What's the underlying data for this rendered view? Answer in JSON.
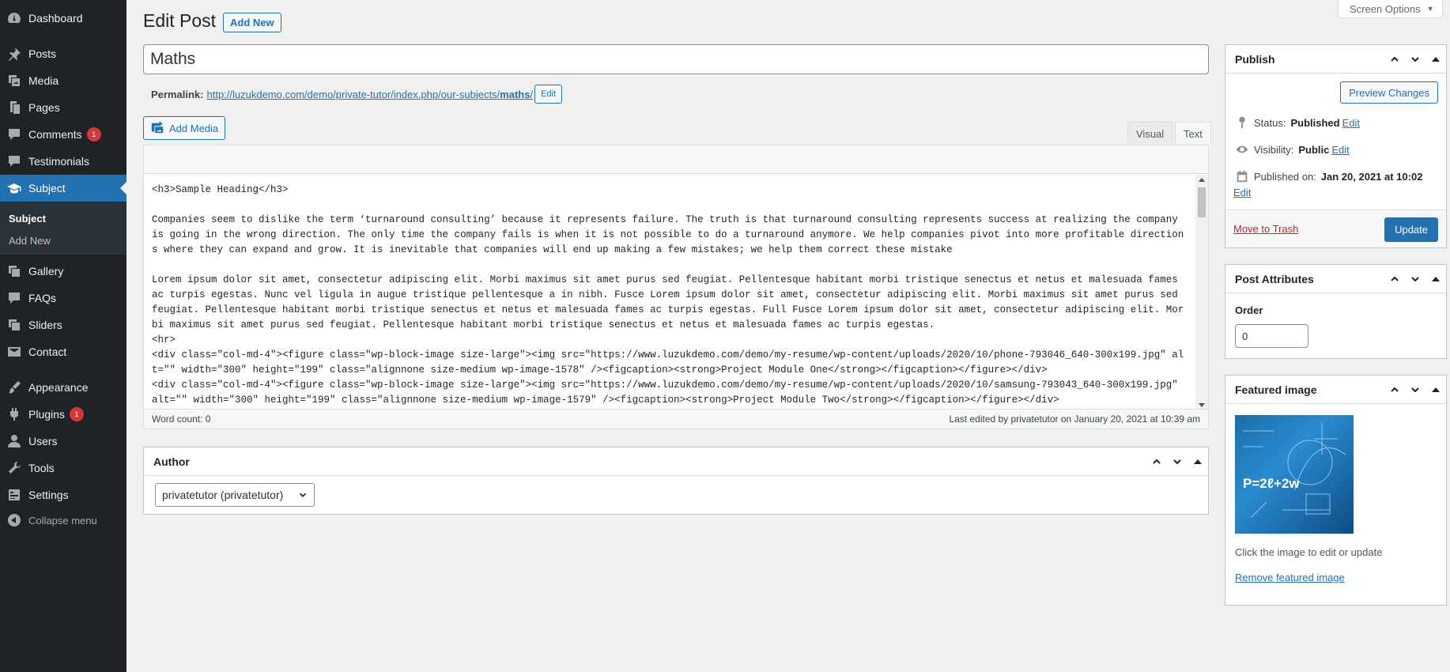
{
  "sidebar": {
    "items": [
      {
        "label": "Dashboard",
        "icon": "dashboard-icon"
      },
      {
        "label": "Posts",
        "icon": "pin-icon"
      },
      {
        "label": "Media",
        "icon": "media-icon"
      },
      {
        "label": "Pages",
        "icon": "pages-icon"
      },
      {
        "label": "Comments",
        "icon": "comment-icon",
        "badge": "1"
      },
      {
        "label": "Testimonials",
        "icon": "comment-icon"
      },
      {
        "label": "Subject",
        "icon": "graduation-cap-icon",
        "current": true
      },
      {
        "label": "Gallery",
        "icon": "gallery-icon"
      },
      {
        "label": "FAQs",
        "icon": "comment-icon"
      },
      {
        "label": "Sliders",
        "icon": "gallery-icon"
      },
      {
        "label": "Contact",
        "icon": "email-icon"
      },
      {
        "label": "Appearance",
        "icon": "brush-icon"
      },
      {
        "label": "Plugins",
        "icon": "plugin-icon",
        "badge": "1"
      },
      {
        "label": "Users",
        "icon": "user-icon"
      },
      {
        "label": "Tools",
        "icon": "wrench-icon"
      },
      {
        "label": "Settings",
        "icon": "settings-icon"
      }
    ],
    "submenu": [
      "Subject",
      "Add New"
    ],
    "collapse_label": "Collapse menu"
  },
  "header": {
    "screen_options": "Screen Options",
    "title": "Edit Post",
    "add_new": "Add New"
  },
  "post": {
    "title": "Maths",
    "permalink_label": "Permalink:",
    "permalink_base": "http://luzukdemo.com/demo/private-tutor/index.php/our-subjects/",
    "permalink_slug": "maths",
    "permalink_end": "/",
    "permalink_edit": "Edit",
    "add_media": "Add Media",
    "tab_visual": "Visual",
    "tab_text": "Text",
    "content": "<h3>Sample Heading</h3>\n\nCompanies seem to dislike the term ‘turnaround consulting’ because it represents failure. The truth is that turnaround consulting represents success at realizing the company is going in the wrong direction. The only time the company fails is when it is not possible to do a turnaround anymore. We help companies pivot into more profitable directions where they can expand and grow. It is inevitable that companies will end up making a few mistakes; we help them correct these mistake\n\nLorem ipsum dolor sit amet, consectetur adipiscing elit. Morbi maximus sit amet purus sed feugiat. Pellentesque habitant morbi tristique senectus et netus et malesuada fames ac turpis egestas. Nunc vel ligula in augue tristique pellentesque a in nibh. Fusce Lorem ipsum dolor sit amet, consectetur adipiscing elit. Morbi maximus sit amet purus sed feugiat. Pellentesque habitant morbi tristique senectus et netus et malesuada fames ac turpis egestas. Full Fusce Lorem ipsum dolor sit amet, consectetur adipiscing elit. Morbi maximus sit amet purus sed feugiat. Pellentesque habitant morbi tristique senectus et netus et malesuada fames ac turpis egestas.\n<hr>\n<div class=\"col-md-4\"><figure class=\"wp-block-image size-large\"><img src=\"https://www.luzukdemo.com/demo/my-resume/wp-content/uploads/2020/10/phone-793046_640-300x199.jpg\" alt=\"\" width=\"300\" height=\"199\" class=\"alignnone size-medium wp-image-1578\" /><figcaption><strong>Project Module One</strong></figcaption></figure></div>\n<div class=\"col-md-4\"><figure class=\"wp-block-image size-large\"><img src=\"https://www.luzukdemo.com/demo/my-resume/wp-content/uploads/2020/10/samsung-793043_640-300x199.jpg\" alt=\"\" width=\"300\" height=\"199\" class=\"alignnone size-medium wp-image-1579\" /><figcaption><strong>Project Module Two</strong></figcaption></figure></div>",
    "word_count": "Word count: 0",
    "last_edited": "Last edited by privatetutor on January 20, 2021 at 10:39 am"
  },
  "author_box": {
    "title": "Author",
    "selected": "privatetutor (privatetutor)"
  },
  "publish": {
    "title": "Publish",
    "preview": "Preview Changes",
    "status_label": "Status:",
    "status_value": "Published",
    "visibility_label": "Visibility:",
    "visibility_value": "Public",
    "published_label": "Published on:",
    "published_value": "Jan 20, 2021 at 10:02",
    "edit": "Edit",
    "trash": "Move to Trash",
    "update": "Update"
  },
  "attributes": {
    "title": "Post Attributes",
    "order_label": "Order",
    "order_value": "0"
  },
  "featured": {
    "title": "Featured image",
    "formula": "P=2ℓ+2w",
    "hint": "Click the image to edit or update",
    "remove": "Remove featured image"
  }
}
